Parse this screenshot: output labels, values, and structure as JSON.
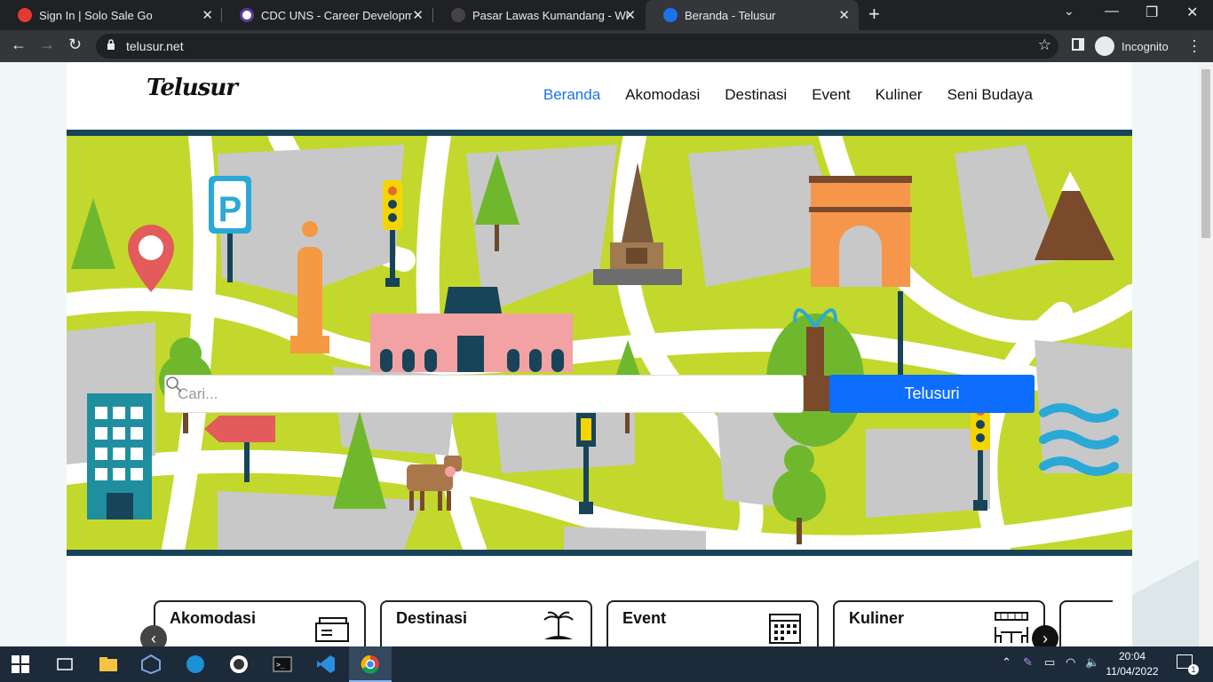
{
  "browser": {
    "tabs": [
      {
        "title": "Sign In | Solo Sale Go",
        "close": "✕"
      },
      {
        "title": "CDC UNS - Career Development",
        "close": "✕"
      },
      {
        "title": "Pasar Lawas Kumandang - Wisata",
        "close": "✕"
      },
      {
        "title": "Beranda - Telusur",
        "close": "✕"
      }
    ],
    "new_tab": "+",
    "url": "telusur.net",
    "incognito_label": "Incognito",
    "window_controls": {
      "minimize": "—",
      "restore": "❐",
      "close": "✕"
    }
  },
  "site": {
    "logo": "Telusur",
    "nav": [
      "Beranda",
      "Akomodasi",
      "Destinasi",
      "Event",
      "Kuliner",
      "Seni Budaya"
    ],
    "active_nav": "Beranda",
    "search": {
      "placeholder": "Cari...",
      "button": "Telusuri"
    },
    "categories": [
      {
        "label": "Akomodasi",
        "icon": "ticket-icon"
      },
      {
        "label": "Destinasi",
        "icon": "palm-island-icon"
      },
      {
        "label": "Event",
        "icon": "calendar-icon"
      },
      {
        "label": "Kuliner",
        "icon": "cafe-table-icon"
      }
    ],
    "carousel": {
      "prev": "‹",
      "next": "›"
    }
  },
  "taskbar": {
    "time": "20:04",
    "date": "11/04/2022",
    "notifications": "1"
  },
  "colors": {
    "accent": "#0d6efd",
    "nav_active": "#1a73e8",
    "hero_green": "#c3d82c",
    "hero_border": "#174458"
  }
}
